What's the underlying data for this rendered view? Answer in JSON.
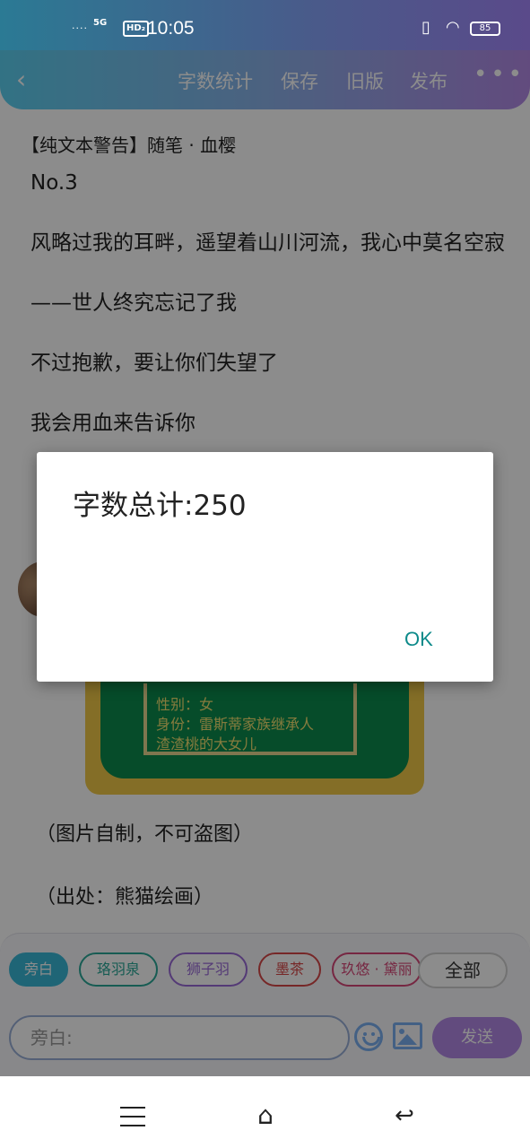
{
  "status_bar": {
    "signal": "....",
    "network": "5G",
    "hd": "HD₂",
    "time": "10:05",
    "battery": "85"
  },
  "top_bar": {
    "back_icon": "chevron-left-icon",
    "actions": [
      "字数统计",
      "保存",
      "旧版",
      "发布"
    ],
    "more_icon": "more-dots-icon"
  },
  "document": {
    "title": "【纯文本警告】随笔 · 血樱",
    "paragraphs": [
      "No.3",
      "风略过我的耳畔，遥望着山川河流，我心中莫名空寂",
      "——世人终究忘记了我",
      "不过抱歉，要让你们失望了",
      "我会用血来告诉你"
    ],
    "card_text": [
      "性别：女",
      "身份：雷斯蒂家族继承人",
      "渣渣桃的大女儿"
    ],
    "notes": [
      "（图片自制，不可盗图）",
      "（出处：熊猫绘画）"
    ]
  },
  "composer": {
    "chips": [
      {
        "label": "旁白",
        "color": "#3ab8d8",
        "filled": true
      },
      {
        "label": "珞羽泉",
        "color": "#2aa898",
        "filled": false
      },
      {
        "label": "狮子羽",
        "color": "#9a6ad8",
        "filled": false
      },
      {
        "label": "墨茶",
        "color": "#d84848",
        "filled": false
      },
      {
        "label": "玖悠 · 黛丽",
        "color": "#d84878",
        "filled": false
      }
    ],
    "all_label": "全部",
    "input_placeholder": "旁白:",
    "emoji_icon": "emoji-icon",
    "image_icon": "image-icon",
    "send_label": "发送"
  },
  "dialog": {
    "message": "字数总计:250",
    "ok_label": "OK"
  },
  "nav_bar": {
    "menu_icon": "menu-icon",
    "home_icon": "home-icon",
    "back_icon": "back-icon"
  }
}
